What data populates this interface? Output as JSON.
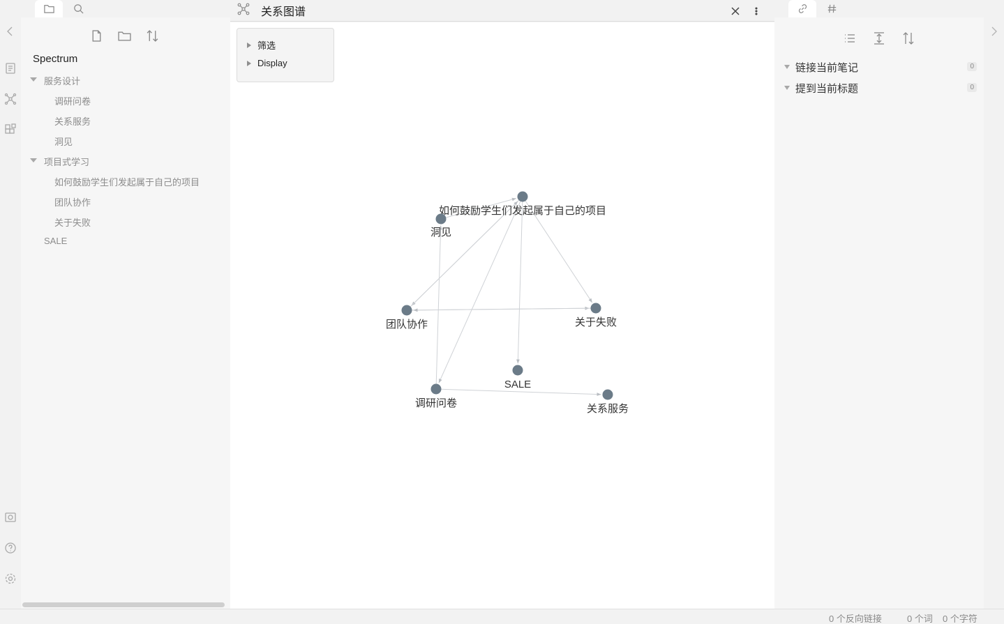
{
  "left_sidebar": {
    "vault_name": "Spectrum",
    "tree": [
      {
        "label": "服务设计",
        "type": "folder",
        "expanded": true
      },
      {
        "label": "调研问卷",
        "type": "file"
      },
      {
        "label": "关系服务",
        "type": "file"
      },
      {
        "label": "洞见",
        "type": "file"
      },
      {
        "label": "项目式学习",
        "type": "folder",
        "expanded": true
      },
      {
        "label": "如何鼓励学生们发起属于自己的项目",
        "type": "file"
      },
      {
        "label": "团队协作",
        "type": "file"
      },
      {
        "label": "关于失败",
        "type": "file"
      },
      {
        "label": "SALE",
        "type": "file"
      }
    ]
  },
  "center": {
    "title": "关系图谱",
    "controls": {
      "filter_label": "筛选",
      "display_label": "Display"
    }
  },
  "graph": {
    "nodes": [
      {
        "id": "proj",
        "label": "如何鼓励学生们发起属于自己的项目"
      },
      {
        "id": "insight",
        "label": "洞见"
      },
      {
        "id": "team",
        "label": "团队协作"
      },
      {
        "id": "fail",
        "label": "关于失败"
      },
      {
        "id": "sale",
        "label": "SALE"
      },
      {
        "id": "survey",
        "label": "调研问卷"
      },
      {
        "id": "service",
        "label": "关系服务"
      }
    ],
    "edges": [
      {
        "from": "proj",
        "to": "team"
      },
      {
        "from": "proj",
        "to": "fail"
      },
      {
        "from": "proj",
        "to": "survey"
      },
      {
        "from": "proj",
        "to": "sale"
      },
      {
        "from": "insight",
        "to": "proj"
      },
      {
        "from": "survey",
        "to": "insight"
      },
      {
        "from": "team",
        "to": "fail"
      },
      {
        "from": "fail",
        "to": "team"
      },
      {
        "from": "survey",
        "to": "service"
      },
      {
        "from": "team",
        "to": "proj"
      }
    ],
    "node_color": "#6b7b88",
    "edge_color": "#cfd2d6"
  },
  "right_sidebar": {
    "backlinks": [
      {
        "label": "链接当前笔记",
        "count": "0"
      },
      {
        "label": "提到当前标题",
        "count": "0"
      }
    ]
  },
  "status_bar": {
    "backlinks": "0 个反向链接",
    "words": "0 个词",
    "chars": "0 个字符"
  },
  "icons": [
    "folder-icon",
    "search-icon",
    "link-icon",
    "hash-icon",
    "graph-icon",
    "close-icon",
    "more-icon",
    "new-note-icon",
    "new-folder-icon",
    "sort-icon",
    "list-icon",
    "collapse-icon",
    "chevron-left-icon",
    "chevron-right-icon",
    "help-icon",
    "settings-icon"
  ]
}
